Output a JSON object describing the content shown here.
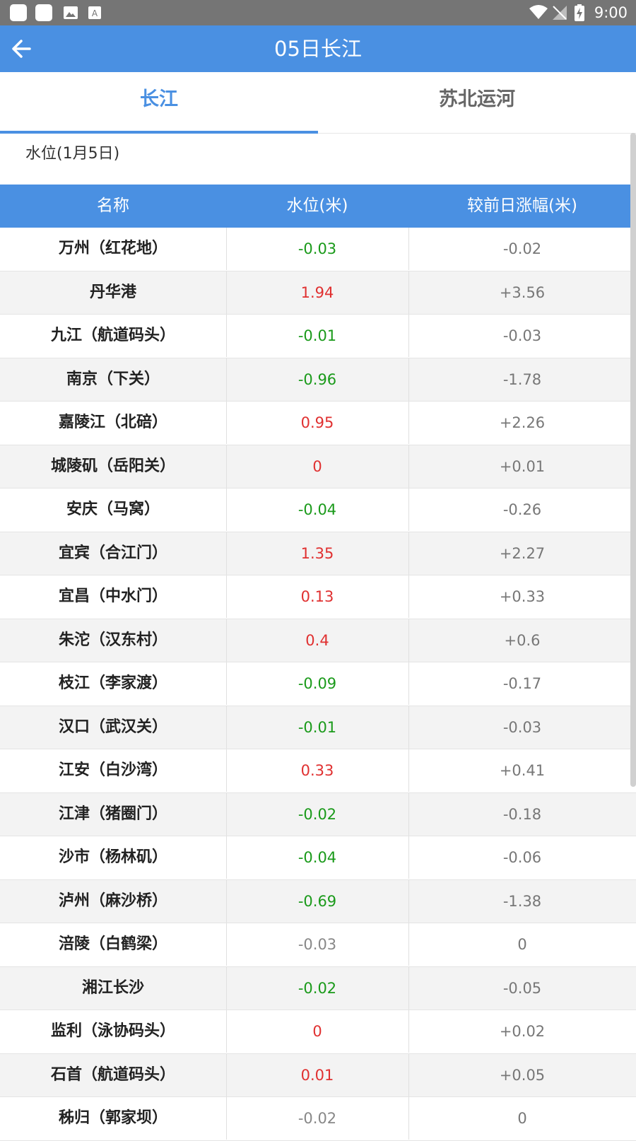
{
  "status_bar": {
    "time": "9:00",
    "left_icons": [
      "notification-icon",
      "notification-icon",
      "image-icon",
      "text-icon"
    ],
    "right_icons": [
      "wifi-icon",
      "signal-icon",
      "battery-icon"
    ]
  },
  "app_bar": {
    "title": "05日长江",
    "back_icon": "arrow-left-icon"
  },
  "tabs": [
    {
      "label": "长江",
      "active": true
    },
    {
      "label": "苏北运河",
      "active": false
    }
  ],
  "section_label": "水位(1月5日)",
  "table": {
    "headers": [
      "名称",
      "水位(米)",
      "较前日涨幅(米)"
    ],
    "rows": [
      {
        "name": "万州（红花地）",
        "level": "-0.03",
        "change": "-0.02",
        "trend": "down"
      },
      {
        "name": "丹华港",
        "level": "1.94",
        "change": "+3.56",
        "trend": "up"
      },
      {
        "name": "九江（航道码头）",
        "level": "-0.01",
        "change": "-0.03",
        "trend": "down"
      },
      {
        "name": "南京（下关）",
        "level": "-0.96",
        "change": "-1.78",
        "trend": "down"
      },
      {
        "name": "嘉陵江（北碚）",
        "level": "0.95",
        "change": "+2.26",
        "trend": "up"
      },
      {
        "name": "城陵矶（岳阳关）",
        "level": "0",
        "change": "+0.01",
        "trend": "up"
      },
      {
        "name": "安庆（马窝）",
        "level": "-0.04",
        "change": "-0.26",
        "trend": "down"
      },
      {
        "name": "宜宾（合江门）",
        "level": "1.35",
        "change": "+2.27",
        "trend": "up"
      },
      {
        "name": "宜昌（中水门）",
        "level": "0.13",
        "change": "+0.33",
        "trend": "up"
      },
      {
        "name": "朱沱（汉东村）",
        "level": "0.4",
        "change": "+0.6",
        "trend": "up"
      },
      {
        "name": "枝江（李家渡）",
        "level": "-0.09",
        "change": "-0.17",
        "trend": "down"
      },
      {
        "name": "汉口（武汉关）",
        "level": "-0.01",
        "change": "-0.03",
        "trend": "down"
      },
      {
        "name": "江安（白沙湾）",
        "level": "0.33",
        "change": "+0.41",
        "trend": "up"
      },
      {
        "name": "江津（猪圈门）",
        "level": "-0.02",
        "change": "-0.18",
        "trend": "down"
      },
      {
        "name": "沙市（杨林矶）",
        "level": "-0.04",
        "change": "-0.06",
        "trend": "down"
      },
      {
        "name": "泸州（麻沙桥）",
        "level": "-0.69",
        "change": "-1.38",
        "trend": "down"
      },
      {
        "name": "涪陵（白鹤梁）",
        "level": "-0.03",
        "change": "0",
        "trend": "flat"
      },
      {
        "name": "湘江长沙",
        "level": "-0.02",
        "change": "-0.05",
        "trend": "down"
      },
      {
        "name": "监利（泳协码头）",
        "level": "0",
        "change": "+0.02",
        "trend": "up"
      },
      {
        "name": "石首（航道码头）",
        "level": "0.01",
        "change": "+0.05",
        "trend": "up"
      },
      {
        "name": "秭归（郭家坝）",
        "level": "-0.02",
        "change": "0",
        "trend": "flat"
      }
    ]
  },
  "colors": {
    "primary": "#4a90e2",
    "rise": "#e03030",
    "fall": "#1a9a1a",
    "neutral": "#888888"
  }
}
